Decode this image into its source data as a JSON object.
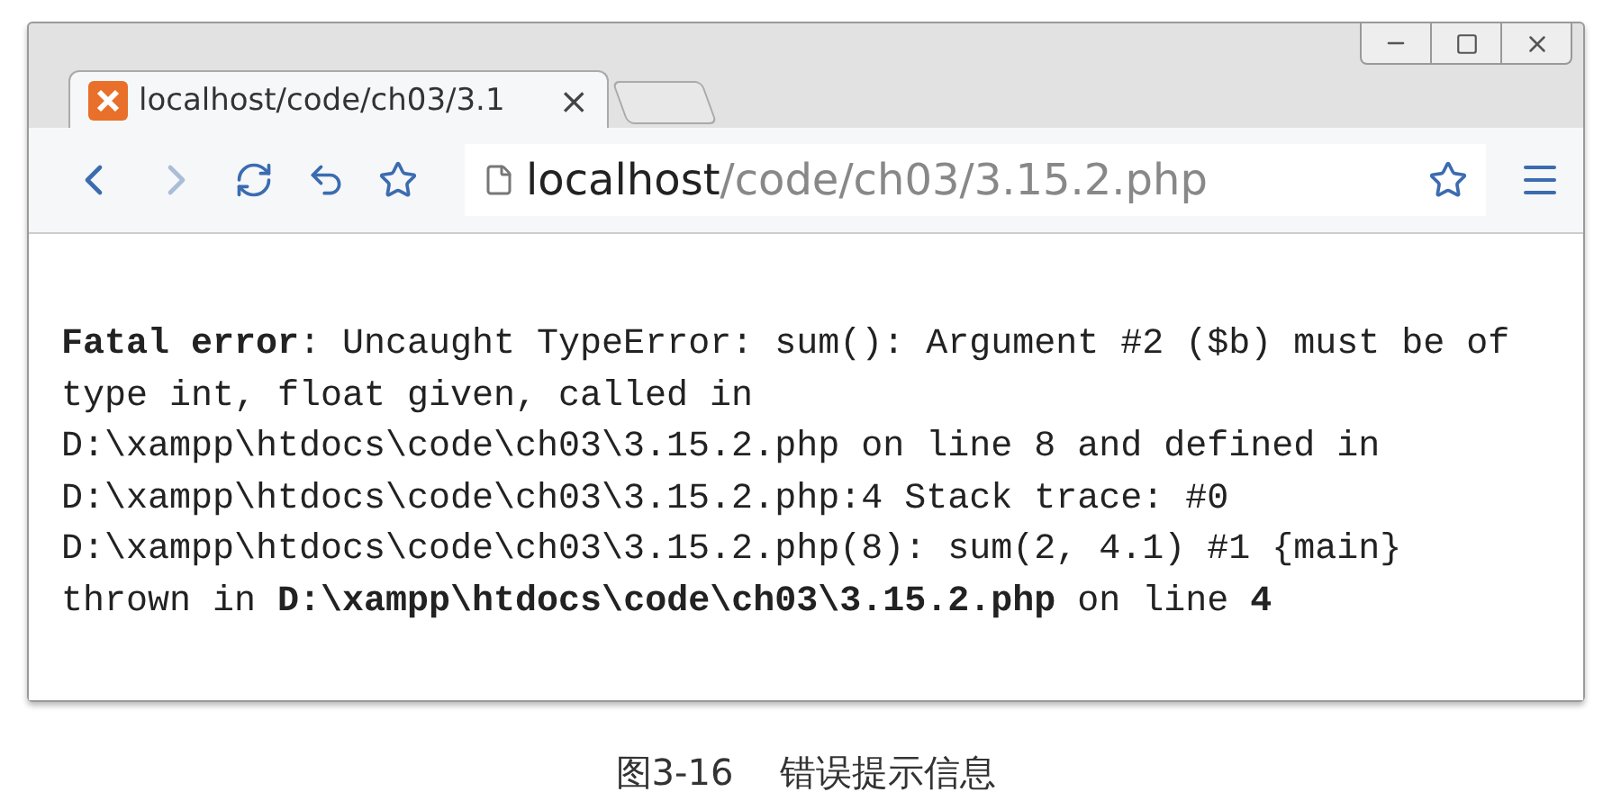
{
  "tabs": [
    {
      "title": "localhost/code/ch03/3.1",
      "selected": true,
      "close": "×"
    }
  ],
  "address_bar": {
    "host": "localhost",
    "path": "/code/ch03/3.15.2.php"
  },
  "page": {
    "message": "**Fatal error**: Uncaught TypeError: sum(): Argument #2 ($b) must be of type int, float given, called in D:\\xampp\\htdocs\\code\\ch03\\3.15.2.php on line 8 and defined in D:\\xampp\\htdocs\\code\\ch03\\3.15.2.php:4 Stack trace: #0 D:\\xampp\\htdocs\\code\\ch03\\3.15.2.php(8): sum(2, 4.1) #1 {main} thrown in **D:\\xampp\\htdocs\\code\\ch03\\3.15.2.php** on line **4**"
  },
  "caption": {
    "figure": "图3-16",
    "text": "错误提示信息"
  }
}
